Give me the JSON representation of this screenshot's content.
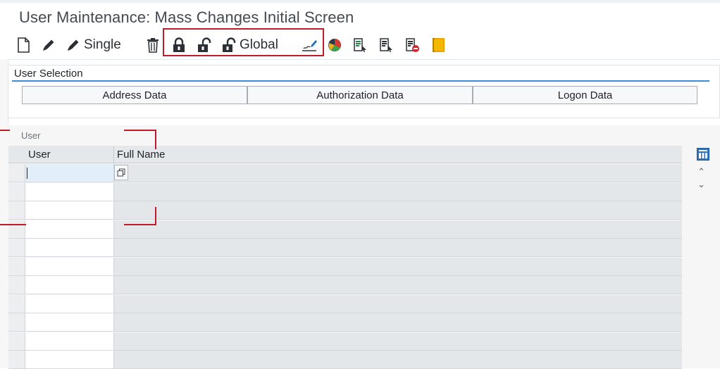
{
  "title": "User Maintenance: Mass Changes Initial Screen",
  "toolbar": {
    "create_icon": "new-document-icon",
    "change_icon": "pencil-icon",
    "single_label": "Single",
    "delete_icon": "trash-icon",
    "lock_icon": "locked-padlock-icon",
    "unlock_icon": "open-padlock-icon",
    "global_label": "Global",
    "password_icon": "signature-edit-icon",
    "status_icon": "pie-status-icon",
    "list1_icon": "select-list-icon",
    "list2_icon": "select-list-alt-icon",
    "list3_icon": "deselect-list-icon",
    "doc_icon": "note-icon"
  },
  "selection": {
    "title": "User Selection",
    "tabs": [
      "Address Data",
      "Authorization Data",
      "Logon Data"
    ]
  },
  "grid": {
    "group_label": "User",
    "columns": [
      "User",
      "Full Name"
    ],
    "rows": [
      {
        "user": "",
        "full_name": ""
      },
      {
        "user": "",
        "full_name": ""
      },
      {
        "user": "",
        "full_name": ""
      },
      {
        "user": "",
        "full_name": ""
      },
      {
        "user": "",
        "full_name": ""
      },
      {
        "user": "",
        "full_name": ""
      },
      {
        "user": "",
        "full_name": ""
      },
      {
        "user": "",
        "full_name": ""
      },
      {
        "user": "",
        "full_name": ""
      },
      {
        "user": "",
        "full_name": ""
      },
      {
        "user": "",
        "full_name": ""
      }
    ]
  },
  "colors": {
    "highlight": "#c01b2a",
    "accent": "#3d8cd8"
  }
}
